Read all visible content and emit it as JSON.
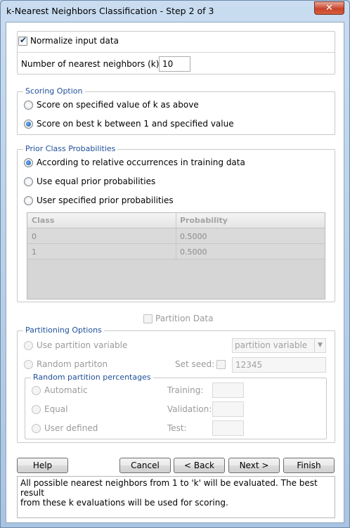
{
  "window": {
    "title": "k-Nearest Neighbors Classification - Step 2 of 3",
    "close_glyph": "✕"
  },
  "options": {
    "normalize_label": "Normalize input data",
    "normalize_checked": true,
    "k_label": "Number of nearest neighbors (k):",
    "k_value": "10"
  },
  "scoring": {
    "legend": "Scoring Option",
    "options": [
      {
        "label": "Score on specified value of k as above",
        "selected": false
      },
      {
        "label": "Score on best k between 1 and specified value",
        "selected": true
      }
    ]
  },
  "prior": {
    "legend": "Prior Class Probabilities",
    "options": [
      {
        "label": "According to relative occurrences in training data",
        "selected": true
      },
      {
        "label": "Use equal prior probabilities",
        "selected": false
      },
      {
        "label": "User specified prior probabilities",
        "selected": false
      }
    ],
    "table": {
      "columns": [
        "Class",
        "Probability"
      ],
      "rows": [
        [
          "0",
          "0.5000"
        ],
        [
          "1",
          "0.5000"
        ]
      ]
    }
  },
  "partition": {
    "checkbox_label": "Partition Data",
    "checked": false,
    "options_legend": "Partitioning Options",
    "use_variable_label": "Use partition variable",
    "variable_select_value": "partition variable",
    "random_label": "Random partiton",
    "set_seed_label": "Set seed:",
    "seed_value": "12345",
    "percentages_legend": "Random partition percentages",
    "modes": [
      "Automatic",
      "Equal",
      "User defined"
    ],
    "fields": [
      {
        "label": "Training:",
        "value": ""
      },
      {
        "label": "Validation:",
        "value": ""
      },
      {
        "label": "Test:",
        "value": ""
      }
    ]
  },
  "buttons": {
    "help": "Help",
    "cancel": "Cancel",
    "back": "< Back",
    "next": "Next >",
    "finish": "Finish"
  },
  "status_text": "All possible nearest neighbors from 1 to 'k' will be evaluated. The best result\nfrom these k evaluations will be used for scoring."
}
